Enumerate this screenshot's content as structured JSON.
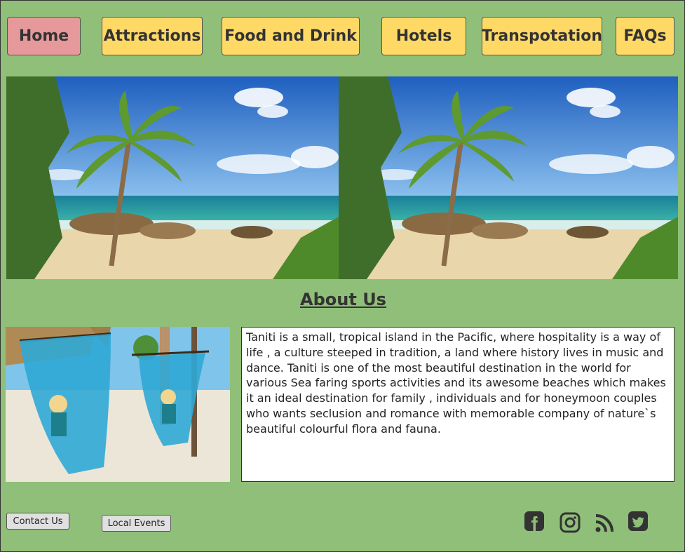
{
  "nav": {
    "items": [
      {
        "label": "Home"
      },
      {
        "label": "Attractions"
      },
      {
        "label": "Food and Drink"
      },
      {
        "label": "Hotels"
      },
      {
        "label": "Transpotation"
      },
      {
        "label": "FAQs"
      }
    ]
  },
  "about": {
    "title": "About Us",
    "text": "Taniti is a small, tropical island in the Pacific, where hospitality is a way of life , a culture steeped in tradition, a land where history lives in music and dance. Taniti is one of the most beautiful destination in the world for various Sea faring sports activities and its awesome beaches which makes it an ideal destination for family , individuals and for honeymoon couples who wants seclusion and romance with memorable company of nature`s beautiful colourful flora and fauna."
  },
  "footer": {
    "contact_label": "Contact Us",
    "events_label": "Local Events"
  },
  "social": [
    "facebook-icon",
    "instagram-icon",
    "rss-icon",
    "twitter-icon"
  ],
  "colors": {
    "background": "#8fbf78",
    "nav_button": "#ffd966",
    "nav_active": "#e6999b",
    "text": "#333333"
  }
}
